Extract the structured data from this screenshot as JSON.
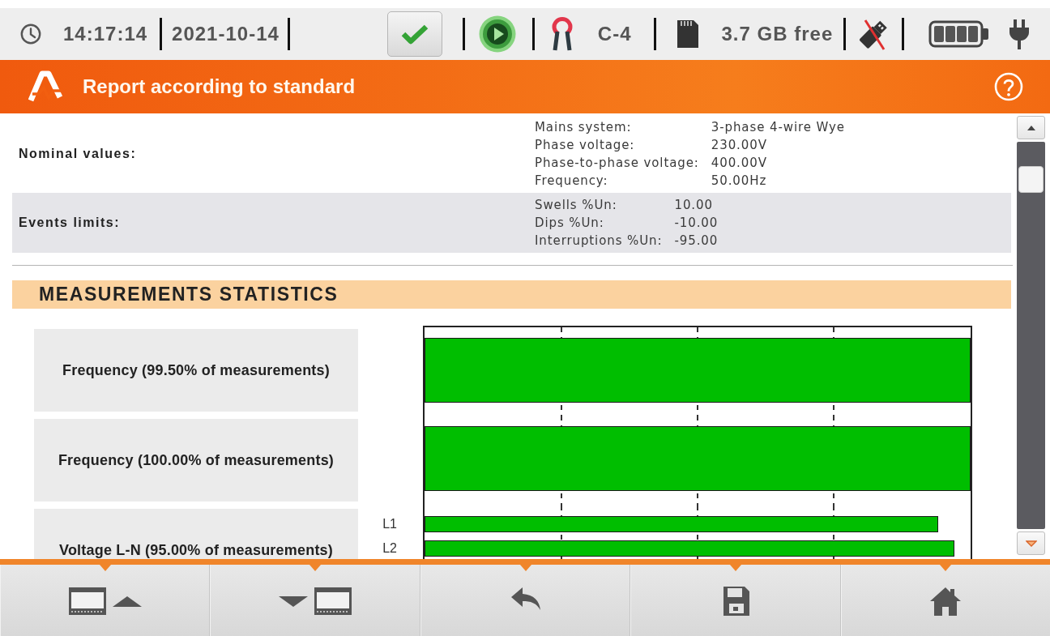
{
  "status_bar": {
    "time": "14:17:14",
    "date": "2021-10-14",
    "input": "C-4",
    "storage": "3.7 GB free"
  },
  "title_bar": {
    "title": "Report according to standard"
  },
  "report": {
    "settings": [
      {
        "label": "Nominal values:",
        "items": [
          {
            "name": "Mains system:",
            "value": "3-phase 4-wire Wye"
          },
          {
            "name": "Phase voltage:",
            "value": "230.00V"
          },
          {
            "name": "Phase-to-phase voltage:",
            "value": "400.00V"
          },
          {
            "name": "Frequency:",
            "value": "50.00Hz"
          }
        ]
      },
      {
        "label": "Events limits:",
        "items": [
          {
            "name": "Swells %Un:",
            "value": "10.00"
          },
          {
            "name": "Dips %Un:",
            "value": "-10.00"
          },
          {
            "name": "Interruptions %Un:",
            "value": "-95.00"
          }
        ]
      }
    ],
    "section_title": "MEASUREMENTS STATISTICS",
    "statistics": [
      {
        "label": "Frequency (99.50% of measurements)",
        "bars": [
          {
            "level": 1
          }
        ]
      },
      {
        "label": "Frequency (100.00% of measurements)",
        "bars": [
          {
            "level": 1
          }
        ]
      },
      {
        "label": "Voltage L-N (95.00% of measurements)",
        "bars": [
          {
            "phase": "L1",
            "level": 0.94
          },
          {
            "phase": "L2",
            "level": 0.97
          }
        ]
      }
    ]
  }
}
